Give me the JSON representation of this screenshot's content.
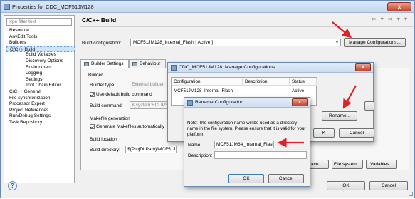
{
  "window": {
    "title": "Properties for CDC_MCF51JM128",
    "close_label": "x"
  },
  "left_panel": {
    "filter_placeholder": "type filter text",
    "tree": [
      {
        "label": "Resource",
        "level": 0
      },
      {
        "label": "AnyEdit Tools",
        "level": 0
      },
      {
        "label": "Builders",
        "level": 0
      },
      {
        "label": "C/C++ Build",
        "level": 0,
        "selected": true
      },
      {
        "label": "Build Variables",
        "level": 1
      },
      {
        "label": "Discovery Options",
        "level": 1
      },
      {
        "label": "Environment",
        "level": 1
      },
      {
        "label": "Logging",
        "level": 1
      },
      {
        "label": "Settings",
        "level": 1
      },
      {
        "label": "Tool Chain Editor",
        "level": 1
      },
      {
        "label": "C/C++ General",
        "level": 0
      },
      {
        "label": "File synchronization",
        "level": 0
      },
      {
        "label": "Processor Expert",
        "level": 0
      },
      {
        "label": "Project References",
        "level": 0
      },
      {
        "label": "Run/Debug Settings",
        "level": 0
      },
      {
        "label": "Task Repository",
        "level": 0
      }
    ]
  },
  "page": {
    "title": "C/C++ Build",
    "nav_icons": "⇦ ▾ ⇨ ▾ ▾",
    "build_config_label": "Build configuration:",
    "build_config_value": "MCF51JM128_Internal_Flash  [ Active ]",
    "manage_button": "Manage Configurations...",
    "tabs": [
      {
        "label": "Builder Settings",
        "active": true
      },
      {
        "label": "Behaviour",
        "active": false
      }
    ],
    "builder_group": "Builder",
    "builder_type_label": "Builder type:",
    "builder_type_value": "External builder",
    "use_default_cmd": "Use default build command",
    "build_command_label": "Build command:",
    "build_command_value": "${system:ECLIPS",
    "makefile_group": "Makefile generation",
    "generate_makefiles": "Generate Makefiles automatically",
    "build_location_group": "Build location",
    "build_dir_label": "Build directory:",
    "build_dir_value": "${ProjDirPath}/MCF51JM",
    "workspace_button": "ace...",
    "filesystem_button": "File system...",
    "variables_button": "Variables...",
    "ok_button": "OK",
    "cancel_button": "Cancel"
  },
  "manage_dialog": {
    "title": "CDC_MCF51JM128: Manage Configurations",
    "columns": [
      "Configuration",
      "Description",
      "Status"
    ],
    "rows": [
      {
        "configuration": "MCF51JM128_Internal_Flash",
        "description": "",
        "status": "Active"
      }
    ],
    "rename_button": "Rename...",
    "cancel_button": "Cancel",
    "ok_partial": "K",
    "variables_partial": "ables..."
  },
  "rename_dialog": {
    "title": "Rename Configuration",
    "note": "Note: The configuration name will be used as a directory name in the file system.  Please ensure that it is valid for your platform.",
    "name_label": "Name:",
    "name_value": "MCF51JM64_Internal_Flash",
    "description_label": "Description:",
    "description_value": "",
    "ok_button": "OK",
    "cancel_button": "Cancel"
  },
  "colors": {
    "annotation_arrow": "#e0202a",
    "selection": "#cde3f8",
    "title_gradient": "#c4d7ef"
  }
}
